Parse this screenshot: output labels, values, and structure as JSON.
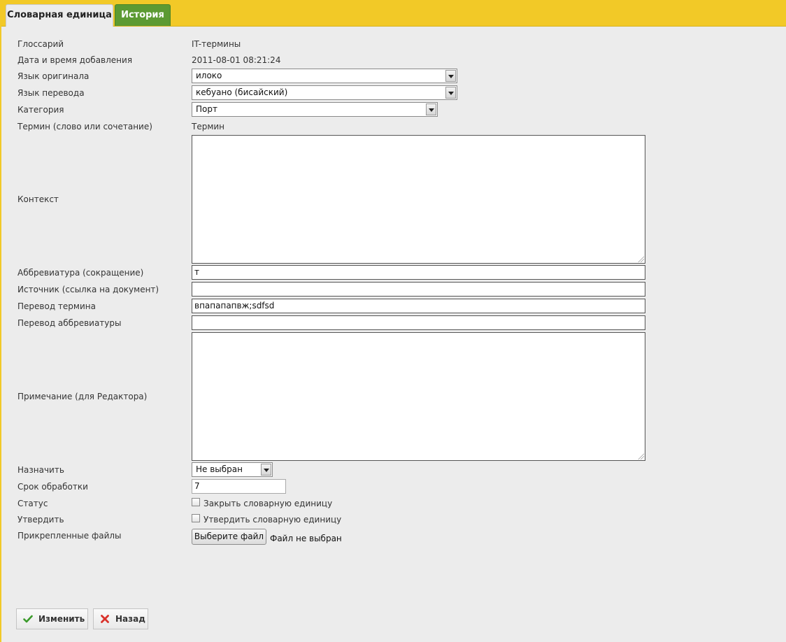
{
  "tabs": [
    {
      "label": "Словарная единица",
      "active": true
    },
    {
      "label": "История",
      "active": false
    }
  ],
  "form": {
    "glossary": {
      "label": "Глоссарий",
      "value": "IT-термины"
    },
    "added": {
      "label": "Дата и время добавления",
      "value": "2011-08-01 08:21:24"
    },
    "source_lang": {
      "label": "Язык оригинала",
      "value": "илоко"
    },
    "target_lang": {
      "label": "Язык перевода",
      "value": "кебуано (бисайский)"
    },
    "category": {
      "label": "Категория",
      "value": "Порт"
    },
    "term": {
      "label": "Термин (слово или сочетание)",
      "value": "Термин"
    },
    "context": {
      "label": "Контекст",
      "value": ""
    },
    "abbreviation": {
      "label": "Аббревиатура (сокращение)",
      "value": "т"
    },
    "source": {
      "label": "Источник (ссылка на документ)",
      "value": ""
    },
    "term_translation": {
      "label": "Перевод термина",
      "value": "впапапапвж;sdfsd"
    },
    "abbr_translation": {
      "label": "Перевод аббревиатуры",
      "value": ""
    },
    "note": {
      "label": "Примечание (для Редактора)",
      "value": ""
    },
    "assign": {
      "label": "Назначить",
      "value": "Не выбран"
    },
    "deadline": {
      "label": "Срок обработки",
      "value": "7"
    },
    "status": {
      "label": "Статус",
      "checkbox_label": "Закрыть словарную единицу",
      "checked": false
    },
    "approve": {
      "label": "Утвердить",
      "checkbox_label": "Утвердить словарную единицу",
      "checked": false
    },
    "files": {
      "label": "Прикрепленные файлы",
      "button": "Выберите файл",
      "status": "Файл не выбран"
    }
  },
  "actions": {
    "save": "Изменить",
    "back": "Назад"
  },
  "colors": {
    "header": "#f2c927",
    "inactive_tab": "#5c9a32",
    "background": "#ececec",
    "save_icon": "#3a9a2a",
    "back_icon": "#d9322b"
  },
  "icons": {
    "save": "checkmark-icon",
    "back": "x-mark-icon"
  }
}
